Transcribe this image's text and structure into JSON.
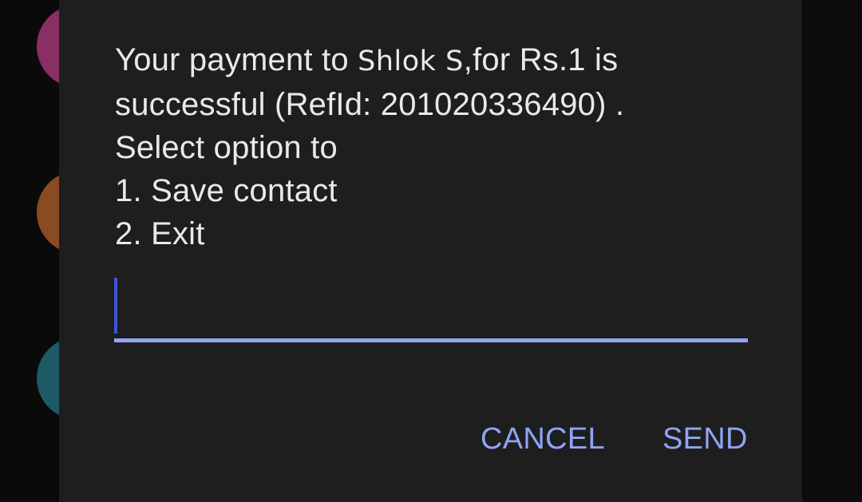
{
  "colors": {
    "dialog_background": "#1e1e1e",
    "text": "#e9e9e9",
    "accent": "#8fa4f5",
    "cursor": "#3a57d6",
    "avatar_colors": [
      "#8a2f63",
      "#8a4a22",
      "#1d5a66"
    ]
  },
  "message": {
    "line1_prefix": "Your payment to ",
    "recipient": "Shlok S",
    "line1_suffix": ",for Rs.1 is",
    "line2": "successful (RefId: 201020336490) .",
    "line3": "Select option to",
    "line4": "1. Save contact",
    "line5": "2. Exit"
  },
  "input": {
    "value": "",
    "placeholder": ""
  },
  "buttons": {
    "cancel_label": "CANCEL",
    "send_label": "SEND"
  }
}
